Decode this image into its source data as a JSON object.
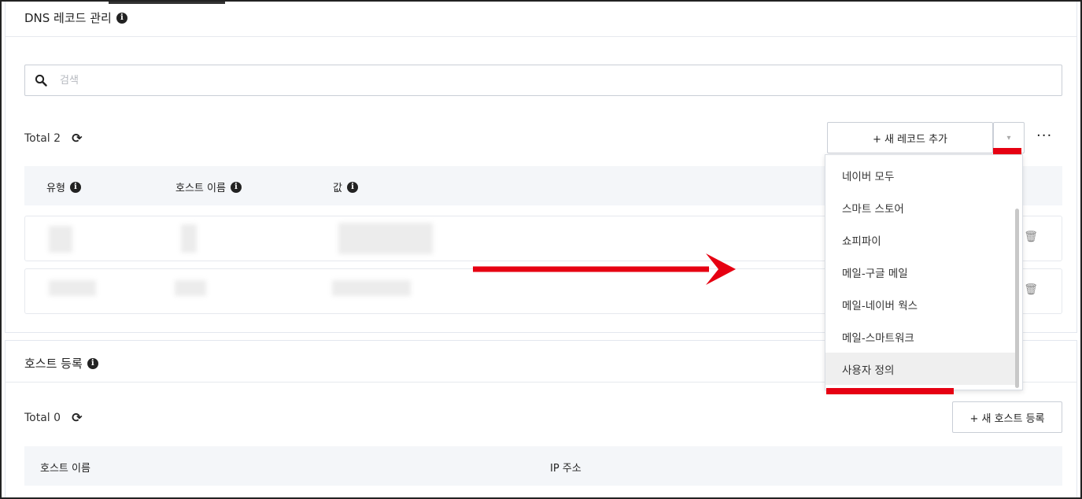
{
  "dns": {
    "title": "DNS 레코드 관리",
    "info_glyph": "i",
    "search_placeholder": "검색",
    "total_label": "Total 2",
    "add_record_label": "+ 새 레코드 추가",
    "dropdown_caret": "▾",
    "more_label": "···",
    "columns": [
      "유형",
      "호스트 이름",
      "값"
    ],
    "dropdown_items": [
      "네이버 모두",
      "스마트 스토어",
      "쇼피파이",
      "메일-구글 메일",
      "메일-네이버 웍스",
      "메일-스마트워크",
      "사용자 정의"
    ],
    "selected_item": "사용자 정의"
  },
  "hosts": {
    "title": "호스트 등록",
    "total_label": "Total 0",
    "add_host_label": "+ 새 호스트 등록",
    "columns": [
      "호스트 이름",
      "IP 주소"
    ]
  },
  "icons": {
    "search": "search-icon",
    "refresh": "refresh-icon",
    "info": "info-icon",
    "trash": "trash-icon",
    "caret": "caret-down-icon"
  },
  "colors": {
    "annotation_red": "#e60012",
    "header_bg": "#f4f6f9",
    "selected_bg": "#efefef"
  }
}
